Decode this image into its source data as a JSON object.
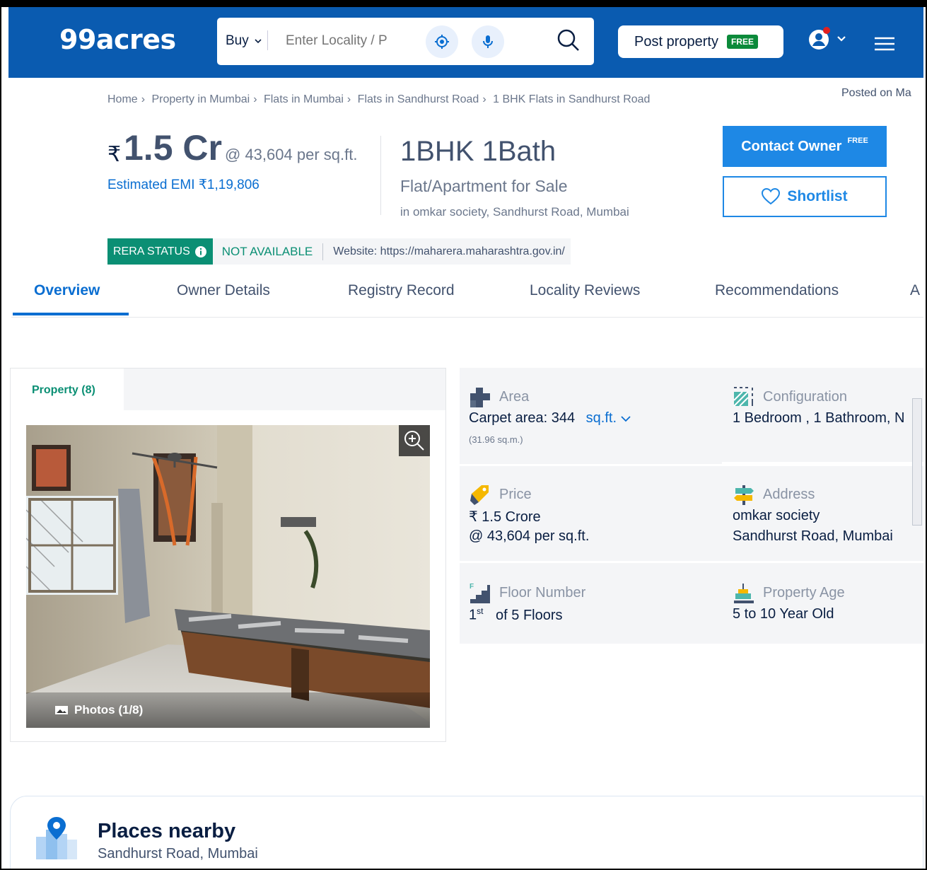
{
  "header": {
    "logo": "99acres",
    "search": {
      "buy_label": "Buy",
      "placeholder": "Enter Locality / P"
    },
    "post_property_label": "Post property",
    "free_tag": "FREE"
  },
  "breadcrumb": [
    "Home",
    "Property in Mumbai",
    "Flats in Mumbai",
    "Flats in Sandhurst Road",
    "1 BHK Flats in Sandhurst Road"
  ],
  "posted_on": "Posted on Ma",
  "price": {
    "currency_symbol": "₹",
    "amount": "1.5 Cr",
    "per_sqft": "@ 43,604 per sq.ft.",
    "emi": "Estimated EMI ₹1,19,806"
  },
  "property": {
    "config_title": "1BHK 1Bath",
    "type": "Flat/Apartment for Sale",
    "location": "in omkar society, Sandhurst Road, Mumbai"
  },
  "actions": {
    "contact_owner": "Contact Owner",
    "contact_free": "FREE",
    "shortlist": "Shortlist"
  },
  "rera": {
    "label": "RERA STATUS",
    "status": "NOT AVAILABLE",
    "website": "Website: https://maharera.maharashtra.gov.in/"
  },
  "tabs": [
    "Overview",
    "Owner Details",
    "Registry Record",
    "Locality Reviews",
    "Recommendations",
    "A"
  ],
  "gallery": {
    "tab_label": "Property (8)",
    "photos_label": "Photos (1/8)"
  },
  "details": {
    "area": {
      "label": "Area",
      "value": "Carpet area: 344",
      "unit": "sq.ft.",
      "sub": "(31.96 sq.m.)"
    },
    "configuration": {
      "label": "Configuration",
      "value": "1 Bedroom , 1 Bathroom, N"
    },
    "price": {
      "label": "Price",
      "value1": "₹ 1.5 Crore",
      "value2": "@ 43,604 per sq.ft."
    },
    "address": {
      "label": "Address",
      "value1": "omkar society",
      "value2": "Sandhurst Road, Mumbai"
    },
    "floor": {
      "label": "Floor Number",
      "value_num": "1",
      "value_sup": "st",
      "value_rest": "of 5 Floors"
    },
    "age": {
      "label": "Property Age",
      "value": "5 to 10 Year Old"
    }
  },
  "places": {
    "title": "Places nearby",
    "subtitle": "Sandhurst Road, Mumbai"
  },
  "colors": {
    "brand_blue": "#0A5BB0",
    "link_blue": "#0A6ED1",
    "rera_green": "#0B8F74",
    "free_green": "#0B8A3A"
  }
}
